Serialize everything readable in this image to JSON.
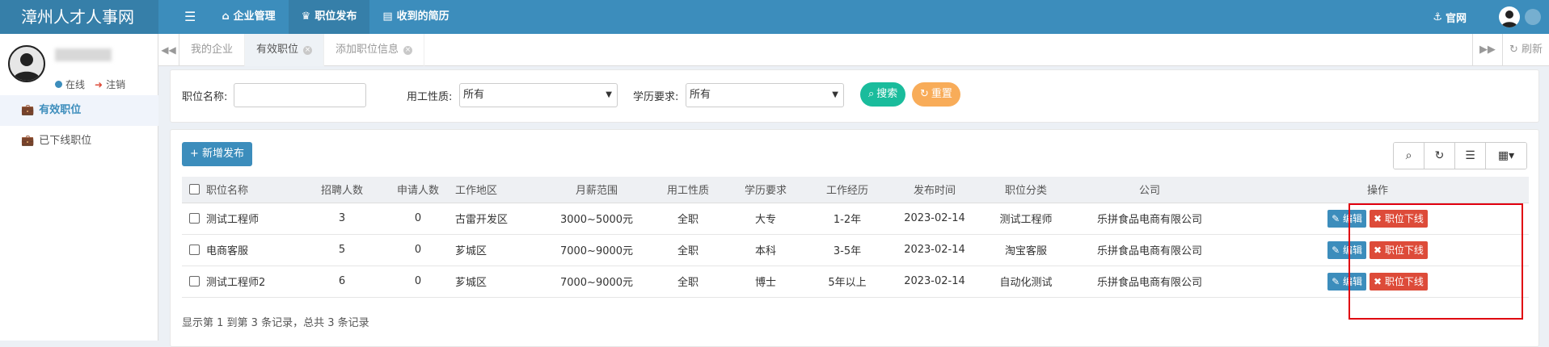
{
  "app_title": "漳州人才人事网",
  "topnav": {
    "menu_icon": "hamburger-icon",
    "items": [
      {
        "label": "企业管理",
        "icon": "home-icon"
      },
      {
        "label": "职位发布",
        "icon": "trophy-icon"
      },
      {
        "label": "收到的简历",
        "icon": "id-card-icon"
      }
    ],
    "site_link": "官网"
  },
  "user": {
    "status": "在线",
    "logout": "注销"
  },
  "sidebar": {
    "items": [
      {
        "label": "有效职位"
      },
      {
        "label": "已下线职位"
      }
    ]
  },
  "tabs": {
    "items": [
      {
        "label": "我的企业"
      },
      {
        "label": "有效职位"
      },
      {
        "label": "添加职位信息"
      }
    ],
    "refresh": "刷新"
  },
  "filter": {
    "name_label": "职位名称:",
    "name_value": "",
    "type_label": "用工性质:",
    "type_value": "所有",
    "edu_label": "学历要求:",
    "edu_value": "所有",
    "search": "搜索",
    "reset": "重置"
  },
  "toolbar": {
    "add": "新增发布"
  },
  "table": {
    "headers": [
      "职位名称",
      "招聘人数",
      "申请人数",
      "工作地区",
      "月薪范围",
      "用工性质",
      "学历要求",
      "工作经历",
      "发布时间",
      "职位分类",
      "公司",
      "操作"
    ],
    "rows": [
      {
        "name": "测试工程师",
        "hire": "3",
        "apply": "0",
        "area": "古雷开发区",
        "salary": "3000~5000元",
        "type": "全职",
        "edu": "大专",
        "exp": "1-2年",
        "date": "2023-02-14",
        "cat": "测试工程师",
        "company": "乐拼食品电商有限公司"
      },
      {
        "name": "电商客服",
        "hire": "5",
        "apply": "0",
        "area": "芗城区",
        "salary": "7000~9000元",
        "type": "全职",
        "edu": "本科",
        "exp": "3-5年",
        "date": "2023-02-14",
        "cat": "淘宝客服",
        "company": "乐拼食品电商有限公司"
      },
      {
        "name": "测试工程师2",
        "hire": "6",
        "apply": "0",
        "area": "芗城区",
        "salary": "7000~9000元",
        "type": "全职",
        "edu": "博士",
        "exp": "5年以上",
        "date": "2023-02-14",
        "cat": "自动化测试",
        "company": "乐拼食品电商有限公司"
      }
    ],
    "edit": "编辑",
    "offline": "职位下线"
  },
  "pagination": "显示第 1 到第 3 条记录，总共 3 条记录",
  "colors": {
    "primary": "#3c8dbc",
    "danger": "#dd4b39",
    "success": "#00a65a",
    "warning": "#f39c12",
    "highlight": "#e0000f"
  }
}
